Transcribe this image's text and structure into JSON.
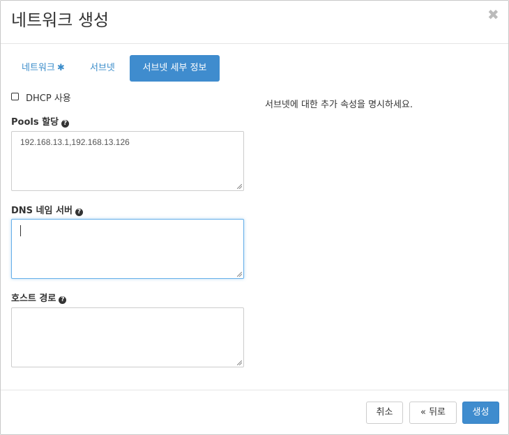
{
  "modal": {
    "title": "네트워크 생성",
    "close_glyph": "✖"
  },
  "tabs": [
    {
      "label": "네트워크",
      "required_mark": "✱"
    },
    {
      "label": "서브넷"
    },
    {
      "label": "서브넷 세부 정보",
      "active": true
    }
  ],
  "form": {
    "dhcp": {
      "label": "DHCP 사용",
      "checked": false
    },
    "pools": {
      "label": "Pools 할당",
      "value": "192.168.13.1,192.168.13.126"
    },
    "dns": {
      "label": "DNS 네임 서버",
      "value": ""
    },
    "host_routes": {
      "label": "호스트 경로",
      "value": ""
    },
    "help_glyph": "?"
  },
  "description": "서브넷에 대한 추가 속성을 명시하세요.",
  "footer": {
    "cancel_label": "취소",
    "back_label": "« 뒤로",
    "create_label": "생성"
  },
  "colors": {
    "primary": "#3f8cce",
    "link": "#3a8cca",
    "focus_border": "#66afe9"
  }
}
